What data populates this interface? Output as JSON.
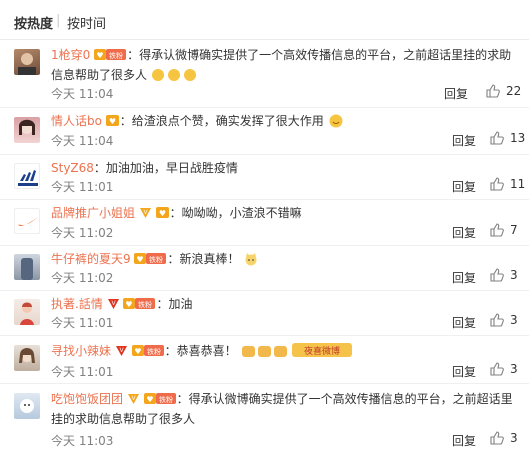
{
  "sort": {
    "hot": "按热度",
    "separator": "|",
    "time": "按时间"
  },
  "comments": [
    {
      "user": "1枪穿0",
      "has_vip": false,
      "has_fan_badge": true,
      "badge_text": "铁粉",
      "text": "：得承认微博确实提供了一个高效传播信息的平台，之前超话里挂的求助信息帮助了很多人",
      "trailing_emoji": "muscle",
      "emoji_count": 3,
      "time": "今天 11:04",
      "reply": "回复",
      "likes": "22"
    },
    {
      "user": "情人话bo",
      "has_vip": false,
      "has_fan_badge": true,
      "badge_text": "",
      "text": "：给渣浪点个赞，确实发挥了很大作用",
      "trailing_emoji": "smile",
      "emoji_count": 1,
      "time": "今天 11:04",
      "reply": "回复",
      "likes": "13"
    },
    {
      "user": "StyZ68",
      "has_vip": false,
      "has_fan_badge": false,
      "badge_text": "",
      "text": "：加油加油，早日战胜疫情",
      "trailing_emoji": "",
      "emoji_count": 0,
      "time": "今天 11:01",
      "reply": "回复",
      "likes": "11"
    },
    {
      "user": "品牌推广小姐姐",
      "has_vip": true,
      "has_fan_badge": true,
      "badge_text": "",
      "text": "：呦呦呦，小渣浪不错嘛",
      "trailing_emoji": "",
      "emoji_count": 0,
      "time": "今天 11:02",
      "reply": "回复",
      "likes": "7"
    },
    {
      "user": "牛仔裤的夏天9",
      "has_vip": false,
      "has_fan_badge": true,
      "badge_text": "铁粉",
      "text": "：新浪真棒！",
      "trailing_emoji": "cat",
      "emoji_count": 1,
      "time": "今天 11:02",
      "reply": "回复",
      "likes": "3"
    },
    {
      "user": "执著.話情",
      "has_vip": true,
      "has_fan_badge": true,
      "badge_text": "铁粉",
      "text": "：加油",
      "trailing_emoji": "",
      "emoji_count": 0,
      "time": "今天 11:01",
      "reply": "回复",
      "likes": "3"
    },
    {
      "user": "寻找小辣妹",
      "has_vip": true,
      "has_fan_badge": true,
      "badge_text": "铁粉",
      "text": "：恭喜恭喜！",
      "trailing_emoji": "thumbs",
      "emoji_count": 3,
      "extra_sticker": "夜喜微博",
      "time": "今天 11:01",
      "reply": "回复",
      "likes": "3"
    },
    {
      "user": "吃饱饱饭团团",
      "has_vip": true,
      "has_fan_badge": true,
      "badge_text": "铁粉",
      "text": "：得承认微博确实提供了一个高效传播信息的平台，之前超话里挂的求助信息帮助了很多人",
      "trailing_emoji": "",
      "emoji_count": 0,
      "time": "今天 11:03",
      "reply": "回复",
      "likes": "3"
    }
  ],
  "colors": {
    "username": "#eb7350",
    "time": "#808080",
    "vip": "#f3a51b",
    "fan_badge": "#ef6b4a"
  }
}
